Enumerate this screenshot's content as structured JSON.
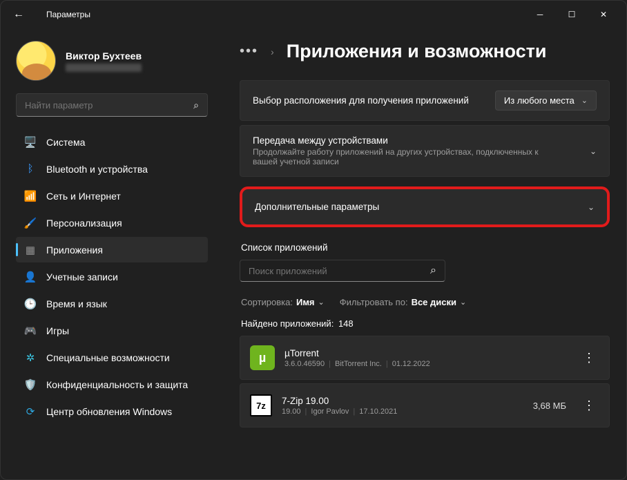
{
  "window": {
    "caption": "Параметры"
  },
  "user": {
    "name": "Виктор Бухтеев"
  },
  "search": {
    "placeholder": "Найти параметр"
  },
  "nav": [
    {
      "label": "Система",
      "icon": "🖥️",
      "c": "#4cc2ff"
    },
    {
      "label": "Bluetooth и устройства",
      "icon": "ᛒ",
      "c": "#3a9bff"
    },
    {
      "label": "Сеть и Интернет",
      "icon": "📶",
      "c": "#29c0d4"
    },
    {
      "label": "Персонализация",
      "icon": "🖌️",
      "c": "#d59a6a"
    },
    {
      "label": "Приложения",
      "icon": "▦",
      "c": "#8f8f8f",
      "selected": true
    },
    {
      "label": "Учетные записи",
      "icon": "👤",
      "c": "#2fbd6b"
    },
    {
      "label": "Время и язык",
      "icon": "🕒",
      "c": "#2f9ae7"
    },
    {
      "label": "Игры",
      "icon": "🎮",
      "c": "#777"
    },
    {
      "label": "Специальные возможности",
      "icon": "✲",
      "c": "#3ac1dd"
    },
    {
      "label": "Конфиденциальность и защита",
      "icon": "🛡️",
      "c": "#888"
    },
    {
      "label": "Центр обновления Windows",
      "icon": "⟳",
      "c": "#2fa8e0"
    }
  ],
  "crumb": {
    "title": "Приложения и возможности"
  },
  "card1": {
    "title": "Выбор расположения для получения приложений",
    "dropdown": "Из любого места"
  },
  "card2": {
    "title": "Передача между устройствами",
    "sub": "Продолжайте работу приложений на других устройствах, подключенных к вашей учетной записи"
  },
  "card3": {
    "title": "Дополнительные параметры"
  },
  "appsSection": "Список приложений",
  "appSearch": {
    "placeholder": "Поиск приложений"
  },
  "sort": {
    "lbl": "Сортировка:",
    "val": "Имя"
  },
  "filter": {
    "lbl": "Фильтровать по:",
    "val": "Все диски"
  },
  "found": {
    "lbl": "Найдено приложений:",
    "count": "148"
  },
  "apps": [
    {
      "name": "µTorrent",
      "ver": "3.6.0.46590",
      "pub": "BitTorrent Inc.",
      "date": "01.12.2022",
      "size": "",
      "iconBg": "#6fb41e",
      "iconTxt": "µ"
    },
    {
      "name": "7-Zip 19.00",
      "ver": "19.00",
      "pub": "Igor Pavlov",
      "date": "17.10.2021",
      "size": "3,68 МБ",
      "iconBg": "#ffffff",
      "iconTxt": "7z"
    }
  ]
}
